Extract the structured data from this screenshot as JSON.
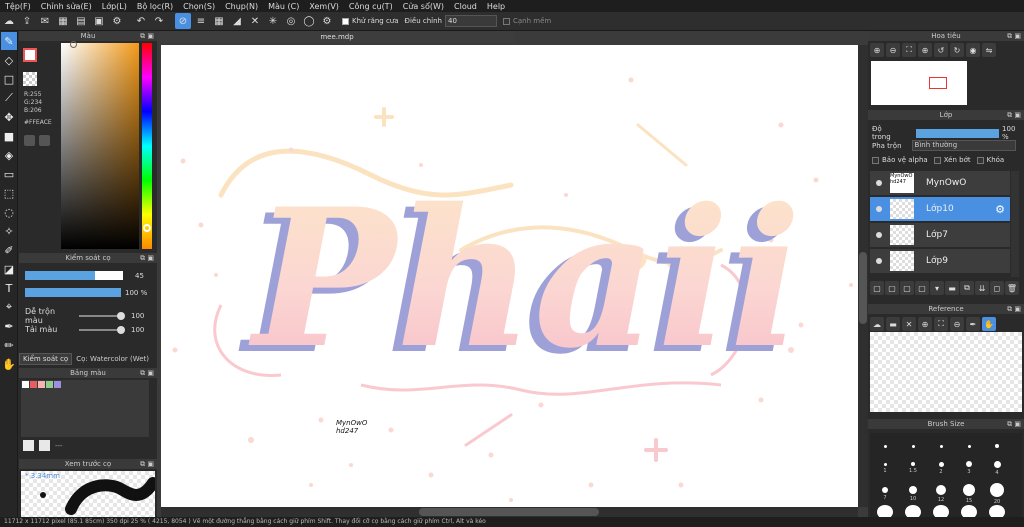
{
  "menu": [
    "Tệp(F)",
    "Chỉnh sửa(E)",
    "Lớp(L)",
    "Bộ lọc(R)",
    "Chọn(S)",
    "Chụp(N)",
    "Màu (C)",
    "Xem(V)",
    "Công cụ(T)",
    "Cửa sổ(W)",
    "Cloud",
    "Help"
  ],
  "toolbar": {
    "antialias_label": "Khử răng cưa",
    "adjust_label": "Điều chỉnh",
    "adjust_value": "40",
    "smooth_label": "Cạnh mềm"
  },
  "color_panel": {
    "title": "Màu",
    "r": "R:255",
    "g": "G:234",
    "b": "B:206",
    "hex": "#FFEACE"
  },
  "brush_panel": {
    "title": "Kiểm soát cọ",
    "size_value": "45",
    "opacity_value": "100 %",
    "blend_label": "Dễ trộn màu",
    "blend_value": "100",
    "reload_label": "Tải màu",
    "reload_value": "100",
    "tab_label": "Kiểm soát cọ",
    "current_brush": "Cọ: Watercolor (Wet)"
  },
  "palette_panel": {
    "title": "Bảng màu",
    "swatches": [
      "#ffffff",
      "#e85d5d",
      "#f5b5b5",
      "#8ecf8e",
      "#9c8ee0"
    ],
    "dash": "---"
  },
  "preview_panel": {
    "title": "Xem trước cọ",
    "size": "* 3.34mm"
  },
  "document": {
    "tab_title": "mee.mdp",
    "artwork_text": "Phaii",
    "watermark_line1": "MynOwO",
    "watermark_line2": "hd247"
  },
  "navigator": {
    "title": "Hoa tiêu"
  },
  "layers": {
    "title": "Lớp",
    "opacity_label": "Độ trong",
    "opacity_value": "100 %",
    "blend_label": "Pha trộn",
    "blend_value": "Bình thường",
    "protect_alpha": "Bảo vệ alpha",
    "clip": "Xén bớt",
    "lock": "Khóa",
    "items": [
      {
        "name": "MynOwO",
        "thumb_text": "MynOwO hd247",
        "selected": false
      },
      {
        "name": "Lớp10",
        "thumb_text": "",
        "selected": true
      },
      {
        "name": "Lớp7",
        "thumb_text": "",
        "selected": false
      },
      {
        "name": "Lớp9",
        "thumb_text": "",
        "selected": false
      }
    ]
  },
  "reference": {
    "title": "Reference"
  },
  "brush_size": {
    "title": "Brush Size",
    "labels": [
      "1",
      "1.5",
      "2",
      "3",
      "4",
      "7",
      "10",
      "12",
      "15",
      "20"
    ]
  },
  "status": "11712 x 11712 pixel   (85.1 85cm)   350 dpi   25 %   ( 4215, 8054 )   Vẽ một đường thẳng bằng cách giữ phím Shift. Thay đổi cỡ cọ bằng cách giữ phím Ctrl, Alt và kéo"
}
